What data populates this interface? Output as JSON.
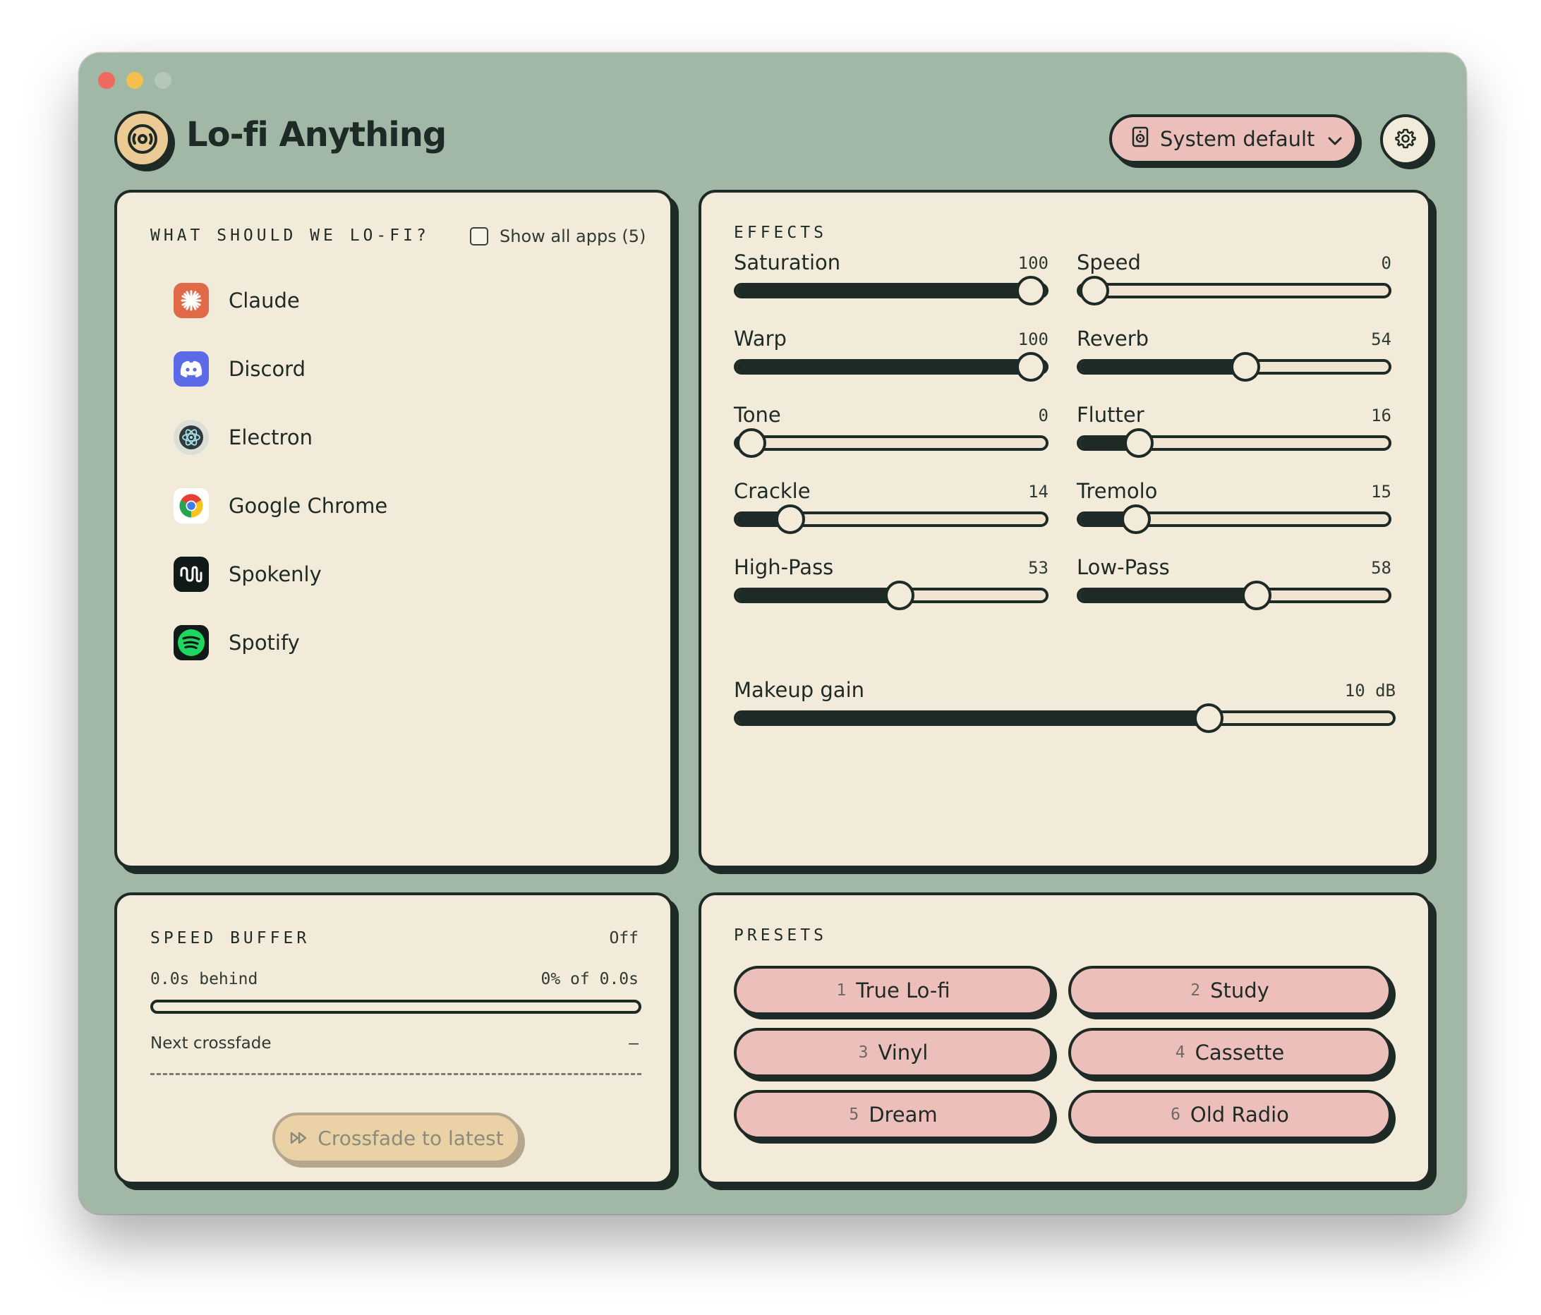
{
  "app": {
    "title": "Lo-fi Anything"
  },
  "header": {
    "device_label": "System default"
  },
  "apps_panel": {
    "title": "WHAT SHOULD WE LO-FI?",
    "show_all_label": "Show all apps (5)",
    "show_all_checked": false,
    "items": [
      {
        "label": "Claude",
        "icon": "claude-icon"
      },
      {
        "label": "Discord",
        "icon": "discord-icon"
      },
      {
        "label": "Electron",
        "icon": "electron-icon"
      },
      {
        "label": "Google Chrome",
        "icon": "chrome-icon"
      },
      {
        "label": "Spokenly",
        "icon": "spokenly-icon"
      },
      {
        "label": "Spotify",
        "icon": "spotify-icon"
      }
    ]
  },
  "effects": {
    "title": "EFFECTS",
    "sliders": [
      {
        "label": "Saturation",
        "value": "100",
        "level": 1.0
      },
      {
        "label": "Speed",
        "value": "0",
        "level": 0.0
      },
      {
        "label": "Warp",
        "value": "100",
        "level": 1.0
      },
      {
        "label": "Reverb",
        "value": "54",
        "level": 0.54
      },
      {
        "label": "Tone",
        "value": "0",
        "level": 0.0
      },
      {
        "label": "Flutter",
        "value": "16",
        "level": 0.16
      },
      {
        "label": "Crackle",
        "value": "14",
        "level": 0.14
      },
      {
        "label": "Tremolo",
        "value": "15",
        "level": 0.15
      },
      {
        "label": "High-Pass",
        "value": "53",
        "level": 0.53
      },
      {
        "label": "Low-Pass",
        "value": "58",
        "level": 0.58
      }
    ],
    "makeup_gain": {
      "label": "Makeup gain",
      "value": "10 dB",
      "level": 0.73
    }
  },
  "speed_buffer": {
    "title": "SPEED BUFFER",
    "status": "Off",
    "behind": "0.0s behind",
    "fill_text": "0% of 0.0s",
    "progress": 0,
    "next_label": "Next crossfade",
    "next_value": "–",
    "crossfade_label": "Crossfade to latest"
  },
  "presets": {
    "title": "PRESETS",
    "items": [
      {
        "num": "1",
        "label": "True Lo-fi"
      },
      {
        "num": "2",
        "label": "Study"
      },
      {
        "num": "3",
        "label": "Vinyl"
      },
      {
        "num": "4",
        "label": "Cassette"
      },
      {
        "num": "5",
        "label": "Dream"
      },
      {
        "num": "6",
        "label": "Old Radio"
      }
    ]
  },
  "colors": {
    "window_bg": "#a0b8a5",
    "panel_bg": "#f3ebd9",
    "ink": "#1e2a25",
    "button_pink": "#ecbfbb",
    "logo_gold": "#ebcb93"
  }
}
